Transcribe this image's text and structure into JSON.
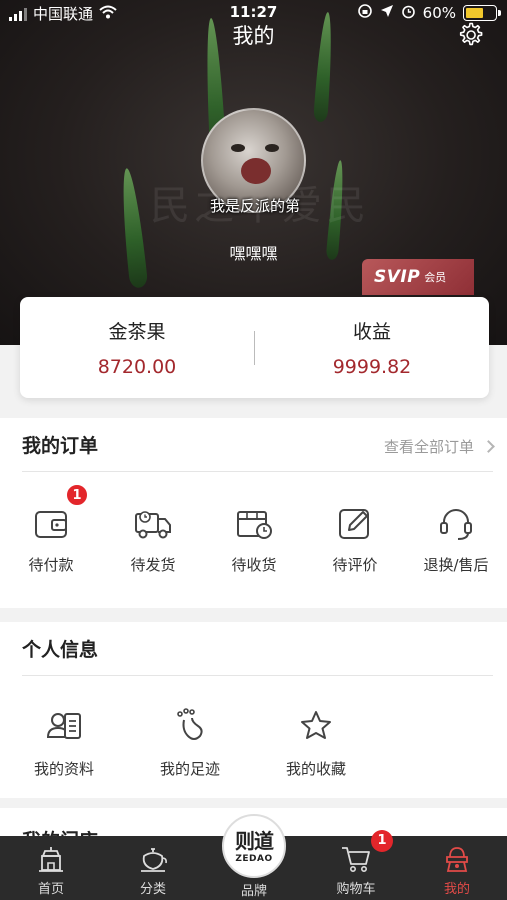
{
  "status_bar": {
    "carrier": "中国联通",
    "time": "11:27",
    "battery": "60%"
  },
  "header": {
    "title": "我的",
    "avatar_caption": "我是反派的第",
    "username": "嘿嘿嘿",
    "background_calligraphy": "民之不爱民",
    "svip": {
      "main": "SVIP",
      "sub": "会员"
    }
  },
  "assets": [
    {
      "label": "金茶果",
      "value": "8720.00"
    },
    {
      "label": "收益",
      "value": "9999.82"
    }
  ],
  "orders": {
    "title": "我的订单",
    "view_all": "查看全部订单",
    "items": [
      {
        "label": "待付款",
        "icon": "wallet-icon",
        "badge": "1"
      },
      {
        "label": "待发货",
        "icon": "delivery-truck-icon"
      },
      {
        "label": "待收货",
        "icon": "package-clock-icon"
      },
      {
        "label": "待评价",
        "icon": "edit-review-icon"
      },
      {
        "label": "退换/售后",
        "icon": "headset-icon"
      }
    ]
  },
  "personal": {
    "title": "个人信息",
    "items": [
      {
        "label": "我的资料",
        "icon": "profile-card-icon"
      },
      {
        "label": "我的足迹",
        "icon": "footprint-icon"
      },
      {
        "label": "我的收藏",
        "icon": "star-icon"
      }
    ]
  },
  "next_section": {
    "title": "我的门店"
  },
  "tabbar": {
    "items": [
      {
        "label": "首页",
        "icon": "home-icon"
      },
      {
        "label": "分类",
        "icon": "teapot-icon"
      },
      {
        "label": "品牌",
        "icon": "brand-logo"
      },
      {
        "label": "购物车",
        "icon": "cart-icon",
        "badge": "1"
      },
      {
        "label": "我的",
        "icon": "profile-icon",
        "active": true
      }
    ],
    "brand_zh": "则道",
    "brand_en": "ZEDAO"
  },
  "colors": {
    "accent": "#a3282d",
    "tab_active": "#e24b48",
    "badge": "#e3262b"
  }
}
